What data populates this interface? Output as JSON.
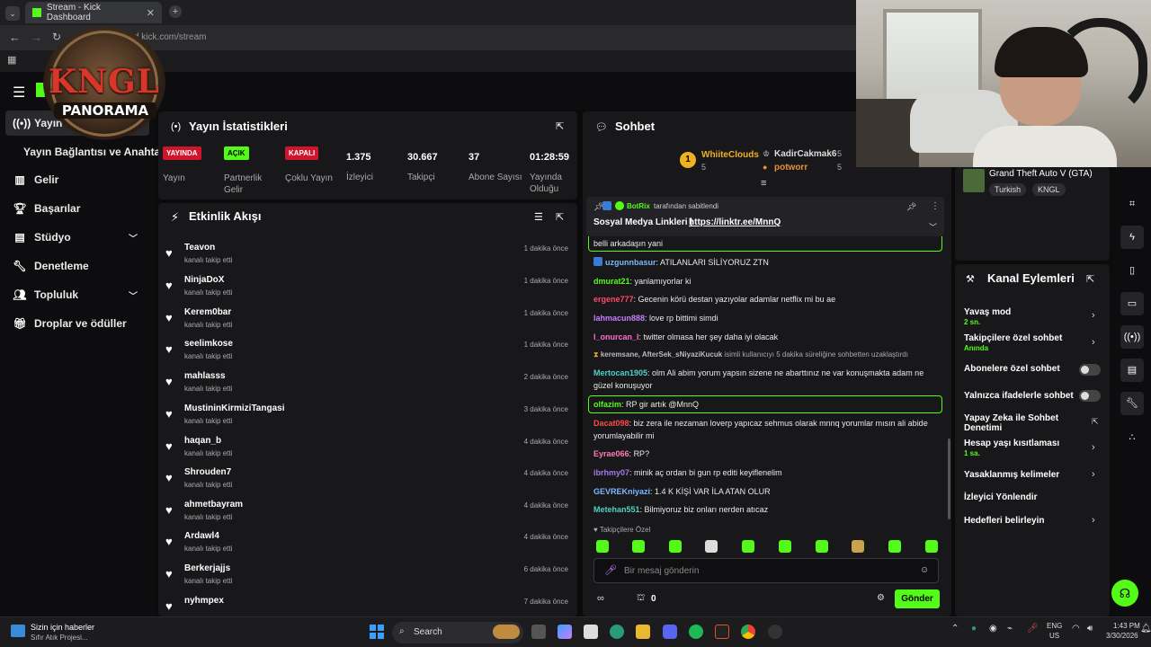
{
  "browser": {
    "tab_title": "Stream - Kick Dashboard",
    "url": "ard.kick.com/stream"
  },
  "overlay": {
    "logo_line1": "KNGL",
    "logo_line2": "PANORAMA"
  },
  "sidebar": {
    "items": [
      {
        "label": "Yayın",
        "icon": "broadcast-icon"
      },
      {
        "label": "Yayın Bağlantısı ve Anahtarı",
        "icon": ""
      },
      {
        "label": "Gelir",
        "icon": "chart-icon"
      },
      {
        "label": "Başarılar",
        "icon": "trophy-icon"
      },
      {
        "label": "Stüdyo",
        "icon": "studio-icon"
      },
      {
        "label": "Denetleme",
        "icon": "wrench-icon"
      },
      {
        "label": "Topluluk",
        "icon": "people-icon"
      },
      {
        "label": "Droplar ve ödüller",
        "icon": "gift-icon"
      }
    ]
  },
  "stats": {
    "title": "Yayın İstatistikleri",
    "items": [
      {
        "pill": "YAYINDA",
        "pill_color": "#d0142c",
        "label": "Yayın"
      },
      {
        "pill": "AÇIK",
        "pill_color": "#53fc18",
        "label": "Partnerlik Gelir"
      },
      {
        "pill": "KAPALI",
        "pill_color": "#d0142c",
        "label": "Çoklu Yayın"
      },
      {
        "value": "1.375",
        "label": "İzleyici"
      },
      {
        "value": "30.667",
        "label": "Takipçi"
      },
      {
        "value": "37",
        "label": "Abone Sayısı"
      },
      {
        "value": "01:28:59",
        "label": "Yayında Olduğu"
      }
    ]
  },
  "activity": {
    "title": "Etkinlik Akışı",
    "items": [
      {
        "name": "Teavon",
        "action": "kanalı takip etti",
        "time": "1 dakika önce"
      },
      {
        "name": "NinjaDoX",
        "action": "kanalı takip etti",
        "time": "1 dakika önce"
      },
      {
        "name": "Kerem0bar",
        "action": "kanalı takip etti",
        "time": "1 dakika önce"
      },
      {
        "name": "seelimkose",
        "action": "kanalı takip etti",
        "time": "1 dakika önce"
      },
      {
        "name": "mahlasss",
        "action": "kanalı takip etti",
        "time": "2 dakika önce"
      },
      {
        "name": "MustininKirmiziTangasi",
        "action": "kanalı takip etti",
        "time": "3 dakika önce"
      },
      {
        "name": "haqan_b",
        "action": "kanalı takip etti",
        "time": "4 dakika önce"
      },
      {
        "name": "Shrouden7",
        "action": "kanalı takip etti",
        "time": "4 dakika önce"
      },
      {
        "name": "ahmetbayram",
        "action": "kanalı takip etti",
        "time": "4 dakika önce"
      },
      {
        "name": "Ardawl4",
        "action": "kanalı takip etti",
        "time": "4 dakika önce"
      },
      {
        "name": "Berkerjajjs",
        "action": "kanalı takip etti",
        "time": "6 dakika önce"
      },
      {
        "name": "nyhmpex",
        "action": "kanalı takip etti",
        "time": "7 dakika önce"
      }
    ]
  },
  "chat": {
    "title": "Sohbet",
    "leaderboard": [
      {
        "rank": "1",
        "name": "WhiiteClouds",
        "count": "5"
      },
      {
        "name": "KadirCakmak6",
        "count": "5"
      },
      {
        "name": "potworr",
        "count": "5"
      }
    ],
    "pinned": {
      "by": "BotRix",
      "by_suffix": "tarafından sabitlendi",
      "text": "Sosyal Medya Linkleri |",
      "link": "https://linktr.ee/MnnQ"
    },
    "messages": [
      {
        "user": "",
        "text": "belli arkadaşın yani",
        "color": "#eaeaea"
      },
      {
        "user": "uzgunnbasur",
        "text": "ATILANLARI SİLİYORUZ ZTN",
        "color": "#7ab8ff"
      },
      {
        "user": "dmurat21",
        "text": "yanlamıyorlar ki",
        "color": "#53fc18"
      },
      {
        "user": "ergene777",
        "text": "Gecenin körü destan yazıyolar adamlar netflix mi bu ae",
        "color": "#ff4a6a"
      },
      {
        "user": "lahmacun888",
        "text": "love rp bittimi simdi",
        "color": "#c77dff"
      },
      {
        "user": "l_onurcan_l",
        "text": "twitter olmasa her şey daha iyi olacak",
        "color": "#ff6bd5"
      },
      {
        "user": "keremsane, AfterSek_sNiyaziKucuk",
        "text": "isimli kullanıcıyı 5 dakika süreliğine sohbetten uzaklaştırdı",
        "color": "#aaaaaa"
      },
      {
        "user": "Mertocan1905",
        "text": "olm Ali abim yorum yapsın sizene ne abarttınız ne var konuşmakta adam ne güzel konuşuyor",
        "color": "#4fd1c5"
      },
      {
        "user": "olfazim",
        "text": "RP gir artık @MnnQ",
        "color": "#53fc18"
      },
      {
        "user": "Dacat098",
        "text": "biz zera ile nezaman loverp yapıcaz sehmus olarak mnnq yorumlar mısın ali abide yorumlayabilir mi",
        "color": "#ff4a4a"
      },
      {
        "user": "Eyrae066",
        "text": "RP?",
        "color": "#ff7ab6"
      },
      {
        "user": "ibrhmy07",
        "text": "minik aç ordan bi gun rp editi keyiflenelim",
        "color": "#9f7aea"
      },
      {
        "user": "GEVREKniyazi",
        "text": "1.4 K KİŞİ VAR İLA ATAN OLUR",
        "color": "#7ab8ff"
      },
      {
        "user": "Metehan551",
        "text": "Bilmiyoruz biz onları nerden atıcaz",
        "color": "#4fd1c5"
      }
    ],
    "followers_only": "Takipçilere Özel",
    "input_placeholder": "Bir mesaj gönderin",
    "points": "0",
    "send_label": "Gönder"
  },
  "stream_info": {
    "game": "Grand Theft Auto V (GTA)",
    "tags": [
      "Turkish",
      "KNGL"
    ]
  },
  "channel_actions": {
    "title": "Kanal Eylemleri",
    "items": [
      {
        "label": "Yavaş mod",
        "sub": "2 sn.",
        "control": "chevron"
      },
      {
        "label": "Takipçilere özel sohbet",
        "sub": "Anında",
        "control": "chevron"
      },
      {
        "label": "Abonelere özel sohbet",
        "sub": "",
        "control": "toggle"
      },
      {
        "label": "Yalnızca ifadelerle sohbet",
        "sub": "",
        "control": "toggle"
      },
      {
        "label": "Yapay Zeka ile Sohbet Denetimi",
        "sub": "",
        "control": "external"
      },
      {
        "label": "Hesap yaşı kısıtlaması",
        "sub": "1 sa.",
        "control": "chevron"
      },
      {
        "label": "Yasaklanmış kelimeler",
        "sub": "",
        "control": "chevron"
      },
      {
        "label": "İzleyici Yönlendir",
        "sub": "",
        "control": "none"
      },
      {
        "label": "Hedefleri belirleyin",
        "sub": "",
        "control": "chevron"
      }
    ]
  },
  "taskbar": {
    "news_title": "Sizin için haberler",
    "news_sub": "Sıfır Atık Projesi...",
    "search": "Search",
    "lang": "ENG",
    "region": "US",
    "time": "1:43 PM",
    "date": "3/30/2026"
  },
  "colors": {
    "accent": "#53fc18",
    "panel": "#18181b",
    "live": "#d0142c"
  }
}
